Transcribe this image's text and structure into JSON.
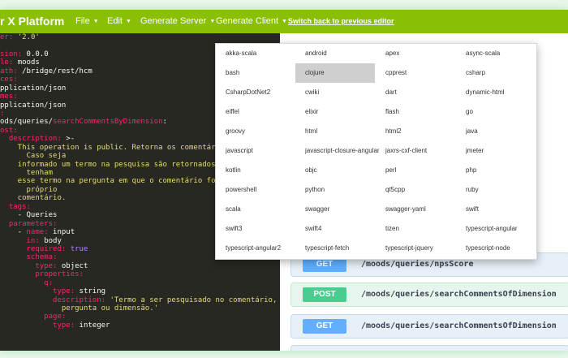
{
  "topbar": {
    "brand": "r X Platform",
    "menus": [
      {
        "label": "File",
        "caret": "▼"
      },
      {
        "label": "Edit",
        "caret": "▼"
      },
      {
        "label": "Generate Server",
        "caret": "▼"
      },
      {
        "label": "Generate Client",
        "caret": "▼"
      }
    ],
    "switch_link": "Switch back to previous editor"
  },
  "editor": {
    "lines": [
      [
        {
          "t": "er: ",
          "c": "k"
        },
        {
          "t": "'2.0'",
          "c": "s"
        }
      ],
      [],
      [
        {
          "t": "sion: ",
          "c": "k"
        },
        {
          "t": "0.0.0",
          "c": "w"
        }
      ],
      [
        {
          "t": "le: ",
          "c": "k"
        },
        {
          "t": "moods",
          "c": "w"
        }
      ],
      [
        {
          "t": "ath: ",
          "c": "k"
        },
        {
          "t": "/bridge/rest/hcm",
          "c": "w"
        }
      ],
      [
        {
          "t": "ces:",
          "c": "k"
        }
      ],
      [
        {
          "t": "pplication/json",
          "c": "w"
        }
      ],
      [
        {
          "t": "mes:",
          "c": "k"
        }
      ],
      [
        {
          "t": "pplication/json",
          "c": "w"
        }
      ],
      [
        {
          "t": ":",
          "c": "k"
        }
      ],
      [
        {
          "t": "ods/queries/",
          "c": "w"
        },
        {
          "t": "searchCommentsByDimension",
          "c": "k"
        },
        {
          "t": ":",
          "c": "w"
        }
      ],
      [
        {
          "t": "ost:",
          "c": "k"
        }
      ],
      [
        {
          "t": "  description: ",
          "c": "k"
        },
        {
          "t": ">-",
          "c": "w"
        }
      ],
      [
        {
          "t": "    This operation is public. Retorna os comentários p",
          "c": "s"
        }
      ],
      [
        {
          "t": "      Caso seja",
          "c": "s"
        }
      ],
      [
        {
          "t": "    informado um termo na pesquisa são retornados os c",
          "c": "s"
        }
      ],
      [
        {
          "t": "      tenham",
          "c": "s"
        }
      ],
      [
        {
          "t": "    esse termo na pergunta em que o comentário foi fei",
          "c": "s"
        }
      ],
      [
        {
          "t": "      próprio",
          "c": "s"
        }
      ],
      [
        {
          "t": "    comentário.",
          "c": "s"
        }
      ],
      [
        {
          "t": "  tags:",
          "c": "k"
        }
      ],
      [
        {
          "t": "    - Queries",
          "c": "w"
        }
      ],
      [
        {
          "t": "  parameters:",
          "c": "k"
        }
      ],
      [
        {
          "t": "    - ",
          "c": "w"
        },
        {
          "t": "name: ",
          "c": "k"
        },
        {
          "t": "input",
          "c": "w"
        }
      ],
      [
        {
          "t": "      in: ",
          "c": "k"
        },
        {
          "t": "body",
          "c": "w"
        }
      ],
      [
        {
          "t": "      required: ",
          "c": "k"
        },
        {
          "t": "true",
          "c": "n"
        }
      ],
      [
        {
          "t": "      schema:",
          "c": "k"
        }
      ],
      [
        {
          "t": "        type: ",
          "c": "k"
        },
        {
          "t": "object",
          "c": "w"
        }
      ],
      [
        {
          "t": "        properties:",
          "c": "k"
        }
      ],
      [
        {
          "t": "          q:",
          "c": "k"
        }
      ],
      [
        {
          "t": "            type: ",
          "c": "k"
        },
        {
          "t": "string",
          "c": "w"
        }
      ],
      [
        {
          "t": "            description: ",
          "c": "k"
        },
        {
          "t": "'Termo a ser pesquisado no comentário,",
          "c": "s"
        }
      ],
      [
        {
          "t": "              pergunta ou dimensão.'",
          "c": "s"
        }
      ],
      [
        {
          "t": "          page:",
          "c": "k"
        }
      ],
      [
        {
          "t": "            type: ",
          "c": "k"
        },
        {
          "t": "integer",
          "c": "w"
        }
      ]
    ]
  },
  "operations": [
    {
      "method": "",
      "path": "",
      "kind": "get",
      "partial": true
    },
    {
      "method": "GET",
      "path": "/moods/queries/npsScore",
      "kind": "get"
    },
    {
      "method": "POST",
      "path": "/moods/queries/searchCommentsOfDimension",
      "kind": "post"
    },
    {
      "method": "GET",
      "path": "/moods/queries/searchCommentsOfDimension",
      "kind": "get"
    }
  ],
  "generate_client": {
    "options": [
      "akka-scala",
      "android",
      "apex",
      "async-scala",
      "bash",
      "clojure",
      "cpprest",
      "csharp",
      "CsharpDotNet2",
      "cwiki",
      "dart",
      "dynamic-html",
      "eiffel",
      "elixir",
      "flash",
      "go",
      "groovy",
      "html",
      "html2",
      "java",
      "javascript",
      "javascript-closure-angular",
      "jaxrs-cxf-client",
      "jmeter",
      "kotlin",
      "objc",
      "perl",
      "php",
      "powershell",
      "python",
      "qt5cpp",
      "ruby",
      "scala",
      "swagger",
      "swagger-yaml",
      "swift",
      "swift3",
      "swift4",
      "tizen",
      "typescript-angular",
      "typescript-angular2",
      "typescript-fetch",
      "typescript-jquery",
      "typescript-node"
    ],
    "highlighted": "clojure"
  },
  "colors": {
    "brand_bar": "#89bf04",
    "get": "#61affe",
    "post": "#49cc90",
    "editor_bg": "#272822"
  }
}
